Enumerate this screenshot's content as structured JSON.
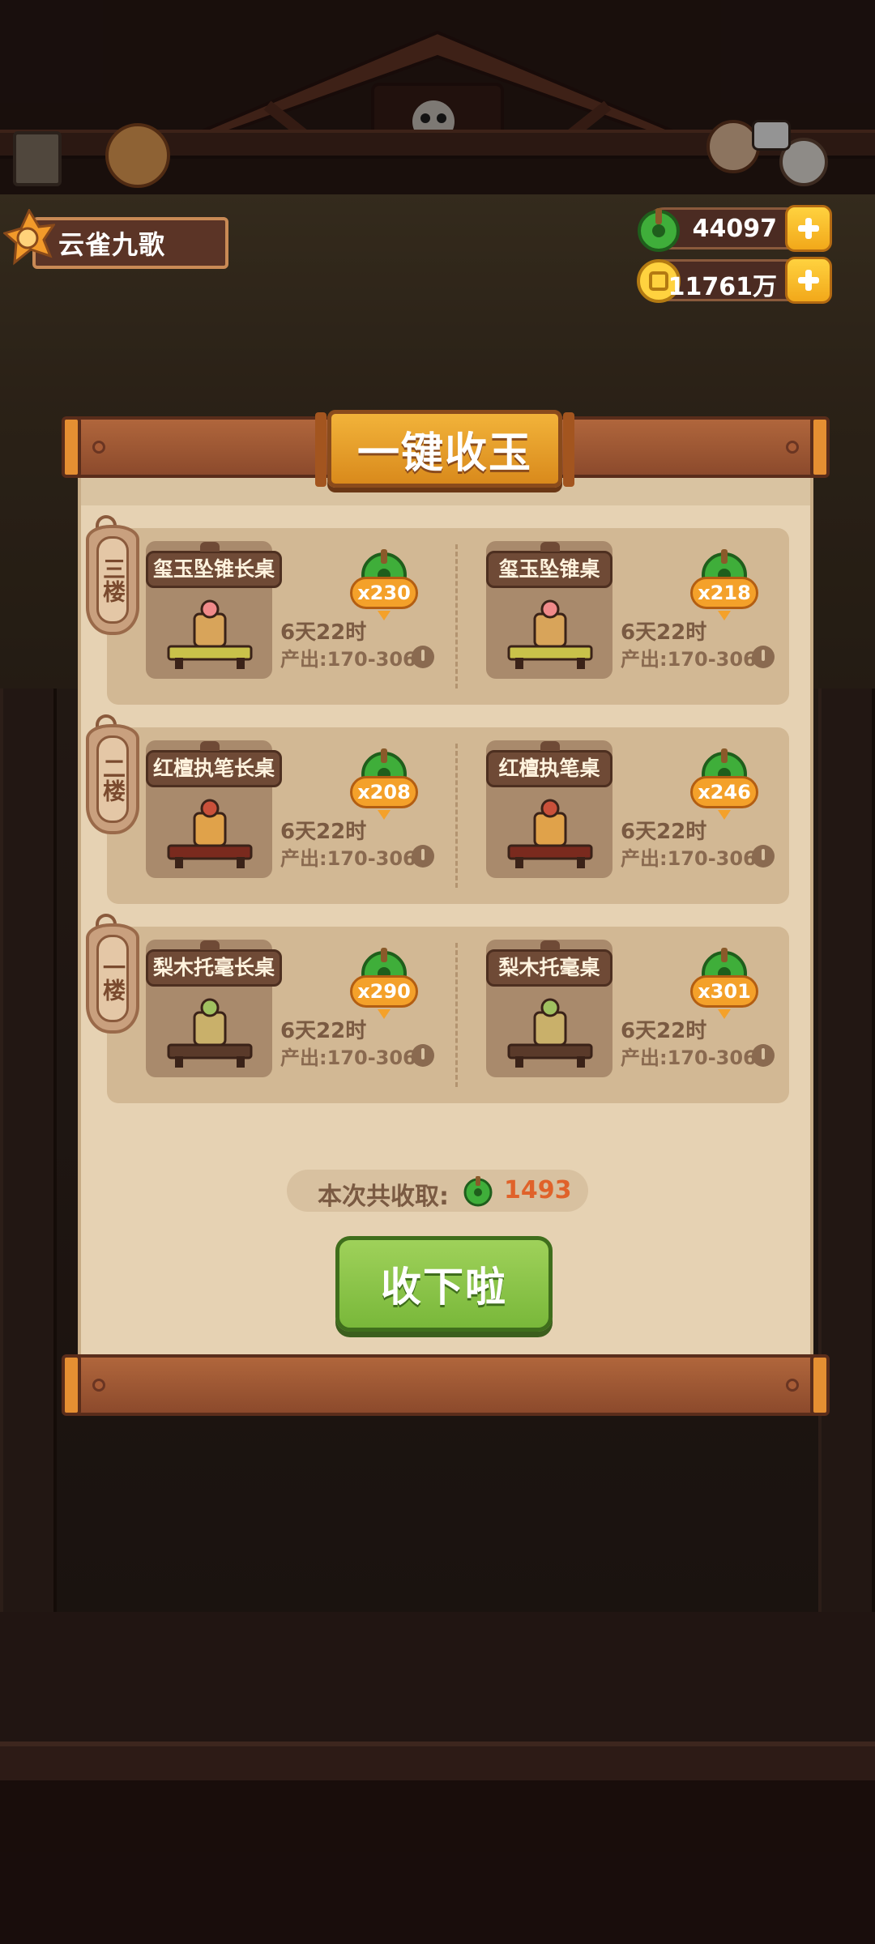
{
  "player": {
    "name": "云雀九歌"
  },
  "currencies": {
    "jade": {
      "value": "44097",
      "icon": "jade-icon"
    },
    "coins": {
      "value": "11761万",
      "icon": "coin-icon"
    }
  },
  "dialog": {
    "title": "一键收玉",
    "floors": [
      {
        "label": "三楼",
        "desks": [
          {
            "name": "玺玉坠锥长桌",
            "count": "x230",
            "time": "6天22时",
            "output": "产出:170-306"
          },
          {
            "name": "玺玉坠锥桌",
            "count": "x218",
            "time": "6天22时",
            "output": "产出:170-306"
          }
        ]
      },
      {
        "label": "二楼",
        "desks": [
          {
            "name": "红檀执笔长桌",
            "count": "x208",
            "time": "6天22时",
            "output": "产出:170-306"
          },
          {
            "name": "红檀执笔桌",
            "count": "x246",
            "time": "6天22时",
            "output": "产出:170-306"
          }
        ]
      },
      {
        "label": "一楼",
        "desks": [
          {
            "name": "梨木托毫长桌",
            "count": "x290",
            "time": "6天22时",
            "output": "产出:170-306"
          },
          {
            "name": "梨木托毫桌",
            "count": "x301",
            "time": "6天22时",
            "output": "产出:170-306"
          }
        ]
      }
    ],
    "total_label": "本次共收取:",
    "total_value": "1493",
    "collect_button": "收下啦"
  },
  "colors": {
    "accent_orange": "#f4a12a",
    "button_green": "#79b83a",
    "total_red": "#e0622a",
    "panel": "#e6d2b3"
  }
}
